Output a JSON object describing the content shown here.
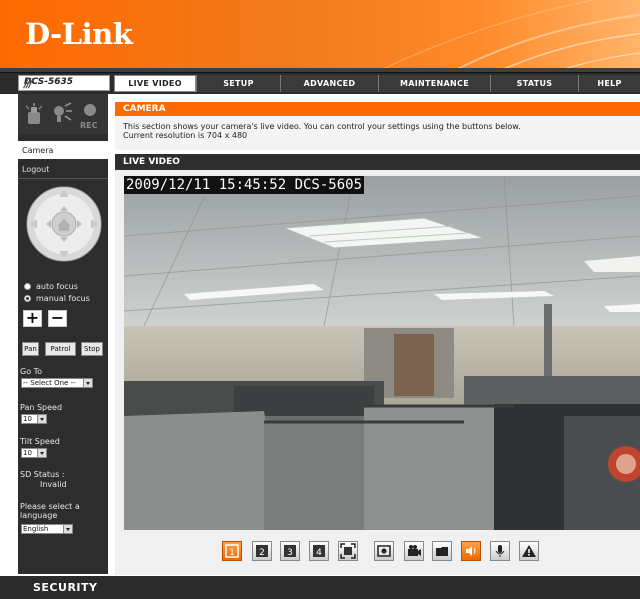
{
  "header": {
    "logo": "D-Link"
  },
  "nav": {
    "model": "DCS-5635",
    "tabs": [
      "LIVE VIDEO",
      "SETUP",
      "ADVANCED",
      "MAINTENANCE",
      "STATUS",
      "HELP"
    ],
    "active_tab": "LIVE VIDEO"
  },
  "sidebar": {
    "icons": [
      "motion-icon",
      "light-icon",
      "rec-icon"
    ],
    "rec_label": "REC",
    "links": [
      "Camera",
      "Logout"
    ],
    "focus": {
      "auto": "auto focus",
      "manual": "manual focus",
      "selected": "manual focus"
    },
    "focus_buttons": [
      "+",
      "−"
    ],
    "patrol_buttons": [
      "Pan",
      "Patrol",
      "Stop"
    ],
    "goto_label": "Go To",
    "goto_value": "-- Select One --",
    "pan_speed_label": "Pan Speed",
    "pan_speed_value": "10",
    "tilt_speed_label": "Tilt Speed",
    "tilt_speed_value": "10",
    "sd_status_label": "SD Status :",
    "sd_status_value": "Invalid",
    "language_label": "Please select a language",
    "language_value": "English"
  },
  "main": {
    "camera_title": "CAMERA",
    "camera_desc": "This section shows your camera's live video. You can control your settings using the buttons below.",
    "resolution": "Current resolution is 704 x 480",
    "live_video_title": "LIVE VIDEO",
    "overlay_text": "2009/12/11 15:45:52 DCS-5605"
  },
  "toolbar": {
    "buttons": [
      "view-1-icon",
      "view-2-icon",
      "view-3-icon",
      "view-4-icon",
      "fullscreen-icon",
      "snapshot-icon",
      "record-icon",
      "folder-icon",
      "speaker-icon",
      "microphone-icon",
      "alert-icon"
    ],
    "active": "view-1-icon"
  },
  "footer": {
    "label": "SECURITY"
  },
  "colors": {
    "brand_orange": "#ff6a00",
    "dark": "#2d2d2d"
  }
}
